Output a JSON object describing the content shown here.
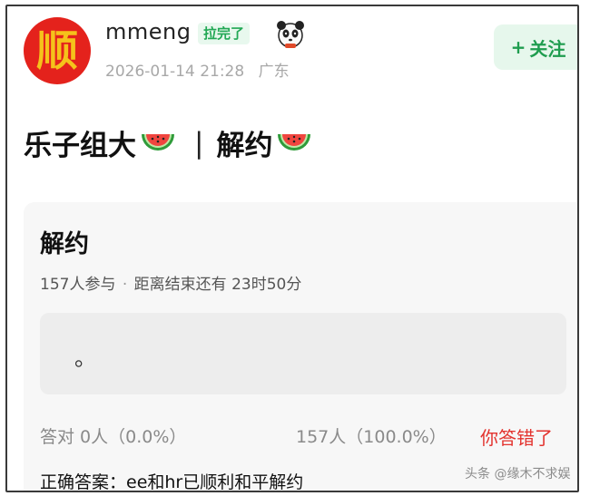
{
  "user": {
    "avatar_char": "顺",
    "name": "mmeng",
    "badge": "拉完了",
    "datetime": "2026-01-14 21:28",
    "location": "广东"
  },
  "follow_button": {
    "plus": "+",
    "label": "关注"
  },
  "post": {
    "title_left": "乐子组大",
    "separator": "|",
    "title_right": "解约"
  },
  "poll": {
    "title": "解约",
    "participants": "157人参与",
    "dot": "·",
    "remaining": "距离结束还有 23时50分",
    "option_text": "。",
    "correct_stat": "答对  0人（0.0%）",
    "wrong_stat": "157人（100.0%）",
    "result": "你答错了",
    "answer": "正确答案：ee和hr已顺利和平解约"
  },
  "watermark": "头条 @缘木不求娱",
  "icons": {
    "panda": "panda-sticker-icon",
    "watermelon": "watermelon-icon"
  },
  "colors": {
    "follow_green": "#1f9d4f",
    "badge_green": "#22a855",
    "error_red": "#e3332e",
    "avatar_red": "#e4221c"
  }
}
